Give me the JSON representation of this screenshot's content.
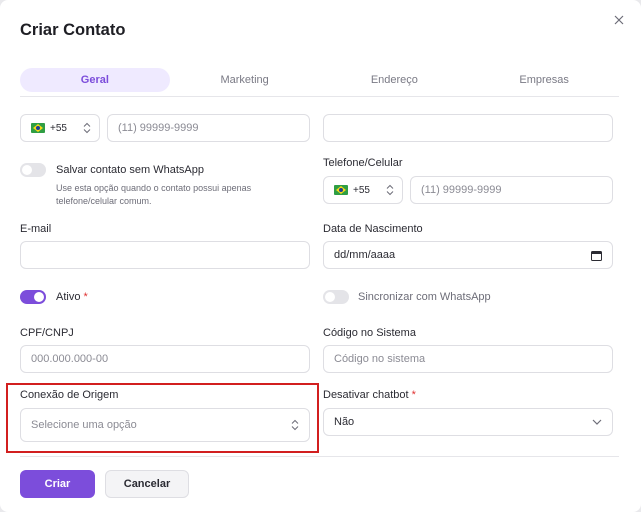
{
  "dialog": {
    "title": "Criar Contato"
  },
  "tabs": [
    {
      "label": "Geral",
      "active": true
    },
    {
      "label": "Marketing",
      "active": false
    },
    {
      "label": "Endereço",
      "active": false
    },
    {
      "label": "Empresas",
      "active": false
    }
  ],
  "phone_top": {
    "country_code": "+55",
    "placeholder": "(11) 99999-9999"
  },
  "whatsapp_toggle": {
    "label": "Salvar contato sem WhatsApp",
    "hint_line1": "Use esta opção quando o contato possui apenas",
    "hint_line2": "telefone/celular comum.",
    "on": false
  },
  "telefone": {
    "label": "Telefone/Celular",
    "country_code": "+55",
    "placeholder": "(11) 99999-9999"
  },
  "email": {
    "label": "E-mail",
    "value": ""
  },
  "nascimento": {
    "label": "Data de Nascimento",
    "placeholder": "dd/mm/aaaa"
  },
  "ativo": {
    "label": "Ativo",
    "required_mark": "*",
    "on": true
  },
  "sincronizar": {
    "label": "Sincronizar com WhatsApp",
    "on": false
  },
  "cpf": {
    "label": "CPF/CNPJ",
    "placeholder": "000.000.000-00"
  },
  "codigo": {
    "label": "Código no Sistema",
    "placeholder": "Código no sistema"
  },
  "conexao": {
    "label": "Conexão de Origem",
    "placeholder": "Selecione uma opção"
  },
  "chatbot": {
    "label": "Desativar chatbot",
    "required_mark": "*",
    "value": "Não"
  },
  "buttons": {
    "create": "Criar",
    "cancel": "Cancelar"
  },
  "colors": {
    "accent": "#7c4ddb",
    "highlight": "#d21f1f",
    "required": "#e03131"
  }
}
